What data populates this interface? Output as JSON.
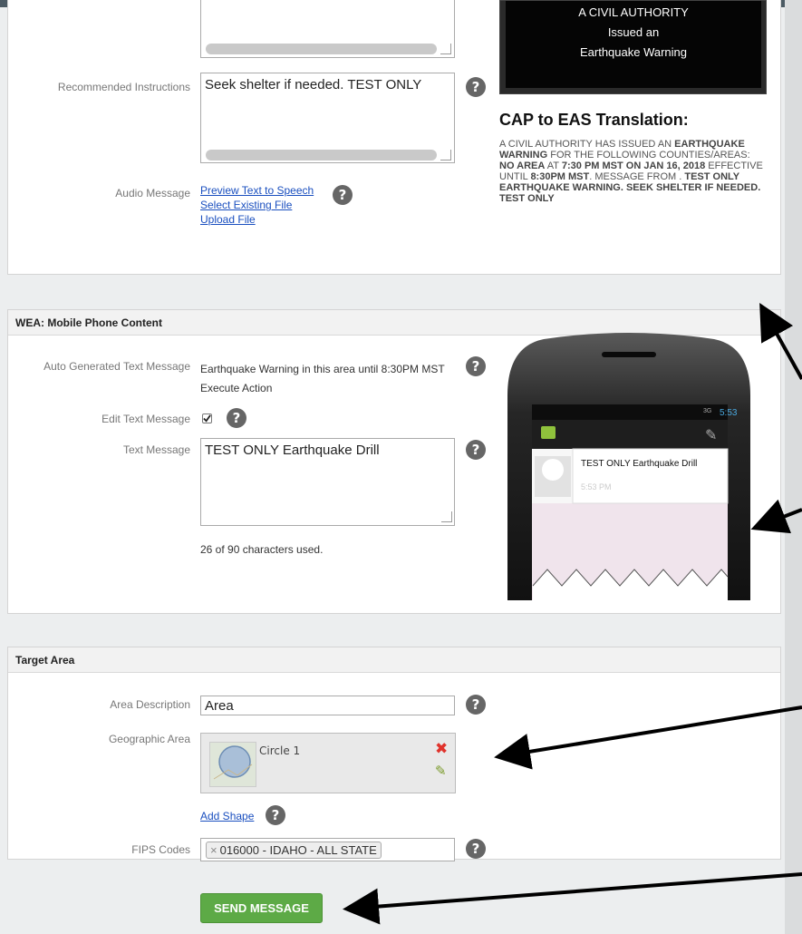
{
  "eas_panel": {
    "recommended_label": "Recommended Instructions",
    "recommended_value": "Seek shelter if needed.  TEST ONLY",
    "audio_label": "Audio Message",
    "audio_links": [
      "Preview Text to Speech",
      "Select Existing File",
      "Upload File"
    ],
    "tv_lines": [
      "A CIVIL AUTHORITY",
      "Issued an",
      "Earthquake Warning"
    ],
    "cap_title": "CAP to EAS Translation:",
    "cap_text": {
      "p1": "A CIVIL AUTHORITY HAS ISSUED AN ",
      "b1": "EARTHQUAKE WARNING",
      "p2": " FOR THE FOLLOWING COUNTIES/AREAS: ",
      "b2": "NO AREA",
      "p3": " AT ",
      "b3": "7:30 PM MST ON JAN 16, 2018",
      "p4": " EFFECTIVE UNTIL ",
      "b4": "8:30PM MST",
      "p5": ". Message from . ",
      "b5": "TEST ONLY EARTHQUAKE WARNING. SEEK SHELTER IF NEEDED. TEST ONLY"
    }
  },
  "wea_panel": {
    "title": "WEA: Mobile Phone Content",
    "auto_label": "Auto Generated Text Message",
    "auto_line1": "Earthquake Warning in this area until 8:30PM MST",
    "auto_line2": "Execute Action",
    "edit_label": "Edit Text Message",
    "text_label": "Text Message",
    "text_value": "TEST ONLY Earthquake Drill",
    "char_count": "26 of 90 characters used.",
    "phone": {
      "time": "5:53",
      "network": "3G",
      "message": "TEST ONLY Earthquake Drill",
      "message_time": "5:53 PM"
    }
  },
  "target_panel": {
    "title": "Target Area",
    "area_desc_label": "Area Description",
    "area_desc_value": "Area",
    "geo_label": "Geographic Area",
    "shape_name": "Circle 1",
    "add_shape": "Add Shape",
    "fips_label": "FIPS Codes",
    "fips_tag": "016000 - IDAHO - ALL STATE",
    "fips_remove": "×"
  },
  "send_button": "SEND MESSAGE",
  "help_glyph": "?",
  "colors": {
    "send_green": "#5daa46",
    "link_blue": "#1a4fbf",
    "remove_red": "#e0332c"
  }
}
